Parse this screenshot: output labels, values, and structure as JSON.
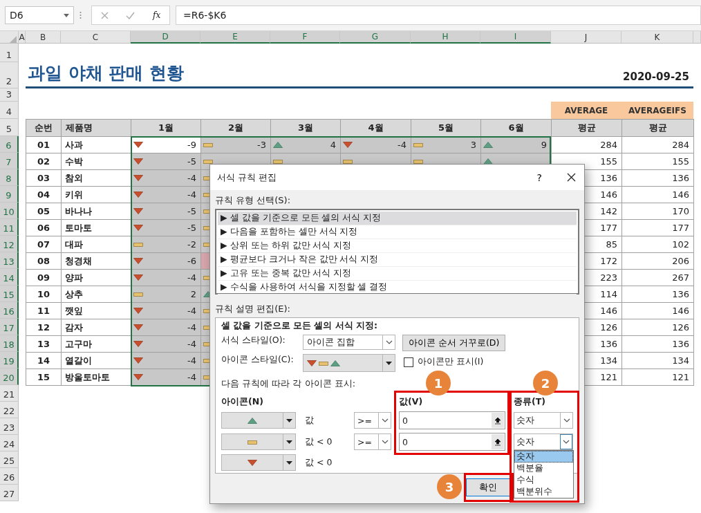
{
  "name_box": {
    "value": "D6"
  },
  "formula_bar": {
    "function_label": "fx",
    "value": "=R6-$K6"
  },
  "column_headers": [
    {
      "label": "A",
      "selected": false
    },
    {
      "label": "B",
      "selected": false
    },
    {
      "label": "C",
      "selected": false
    },
    {
      "label": "D",
      "selected": true
    },
    {
      "label": "E",
      "selected": true
    },
    {
      "label": "F",
      "selected": true
    },
    {
      "label": "G",
      "selected": true
    },
    {
      "label": "H",
      "selected": true
    },
    {
      "label": "I",
      "selected": true
    },
    {
      "label": "J",
      "selected": false
    },
    {
      "label": "K",
      "selected": false
    }
  ],
  "row_headers": [
    {
      "label": "1",
      "selected": false
    },
    {
      "label": "2",
      "selected": false
    },
    {
      "label": "3",
      "selected": false
    },
    {
      "label": "4",
      "selected": false
    },
    {
      "label": "5",
      "selected": false
    },
    {
      "label": "6",
      "selected": true
    },
    {
      "label": "7",
      "selected": true
    },
    {
      "label": "8",
      "selected": true
    },
    {
      "label": "9",
      "selected": true
    },
    {
      "label": "10",
      "selected": true
    },
    {
      "label": "11",
      "selected": true
    },
    {
      "label": "12",
      "selected": true
    },
    {
      "label": "13",
      "selected": true
    },
    {
      "label": "14",
      "selected": true
    },
    {
      "label": "15",
      "selected": true
    },
    {
      "label": "16",
      "selected": true
    },
    {
      "label": "17",
      "selected": true
    },
    {
      "label": "18",
      "selected": true
    },
    {
      "label": "19",
      "selected": true
    },
    {
      "label": "20",
      "selected": true
    },
    {
      "label": "21",
      "selected": false
    },
    {
      "label": "22",
      "selected": false
    },
    {
      "label": "23",
      "selected": false
    },
    {
      "label": "24",
      "selected": false
    },
    {
      "label": "25",
      "selected": false
    },
    {
      "label": "26",
      "selected": false
    },
    {
      "label": "27",
      "selected": false
    }
  ],
  "sheet_title": "과일 야채 판매 현황",
  "report_date": "2020-09-25",
  "formula_notes": [
    "AVERAGE",
    "AVERAGEIFS"
  ],
  "table": {
    "headers": [
      "순번",
      "제품명",
      "1월",
      "2월",
      "3월",
      "4월",
      "5월",
      "6월",
      "평균",
      "평균"
    ],
    "rows": [
      {
        "no": "01",
        "name": "사과",
        "months": [
          {
            "kind": "down",
            "value": "-9",
            "active": true,
            "highlighted": false
          },
          {
            "kind": "bar",
            "value": "-3",
            "active": false,
            "highlighted": false
          },
          {
            "kind": "up",
            "value": "4",
            "active": false,
            "highlighted": false
          },
          {
            "kind": "down",
            "value": "-4",
            "active": false,
            "highlighted": false
          },
          {
            "kind": "bar",
            "value": "3",
            "active": false,
            "highlighted": false
          },
          {
            "kind": "up",
            "value": "9",
            "active": false,
            "highlighted": false
          }
        ],
        "average": "284",
        "averageifs": "284"
      },
      {
        "no": "02",
        "name": "수박",
        "months": [
          {
            "kind": "down",
            "value": "-5",
            "active": false,
            "highlighted": false
          },
          {
            "kind": "bar",
            "active": false,
            "highlighted": false
          },
          {
            "kind": "bar",
            "active": false,
            "highlighted": false
          },
          {
            "kind": "bar",
            "active": false,
            "highlighted": false
          },
          {
            "kind": "bar",
            "active": false,
            "highlighted": false
          },
          {
            "kind": "up",
            "active": false,
            "highlighted": false
          }
        ],
        "average": "155",
        "averageifs": "155"
      },
      {
        "no": "03",
        "name": "참외",
        "months": [
          {
            "kind": "down",
            "value": "-4",
            "active": false,
            "highlighted": false
          },
          {
            "kind": "bar",
            "active": false,
            "highlighted": false
          }
        ],
        "average": "136",
        "averageifs": "136"
      },
      {
        "no": "04",
        "name": "키위",
        "months": [
          {
            "kind": "down",
            "value": "-4",
            "active": false,
            "highlighted": false
          },
          {
            "kind": "bar",
            "active": false,
            "highlighted": false
          }
        ],
        "average": "146",
        "averageifs": "146"
      },
      {
        "no": "05",
        "name": "바나나",
        "months": [
          {
            "kind": "down",
            "value": "-5",
            "active": false,
            "highlighted": false
          },
          {
            "kind": "bar",
            "active": false,
            "highlighted": false
          }
        ],
        "average": "142",
        "averageifs": "170"
      },
      {
        "no": "06",
        "name": "토마토",
        "months": [
          {
            "kind": "down",
            "value": "-5",
            "active": false,
            "highlighted": false
          },
          {
            "kind": "bar",
            "active": false,
            "highlighted": false
          }
        ],
        "average": "177",
        "averageifs": "177"
      },
      {
        "no": "07",
        "name": "대파",
        "months": [
          {
            "kind": "bar",
            "value": "-2",
            "active": false,
            "highlighted": false
          },
          {
            "kind": "bar",
            "active": false,
            "highlighted": false
          }
        ],
        "average": "85",
        "averageifs": "102"
      },
      {
        "no": "08",
        "name": "청경채",
        "months": [
          {
            "kind": "down",
            "value": "-6",
            "active": false,
            "highlighted": false
          },
          {
            "active": false,
            "highlighted": true
          }
        ],
        "average": "172",
        "averageifs": "206"
      },
      {
        "no": "09",
        "name": "양파",
        "months": [
          {
            "kind": "down",
            "value": "-4",
            "active": false,
            "highlighted": false
          },
          {
            "kind": "bar",
            "active": false,
            "highlighted": false
          }
        ],
        "average": "223",
        "averageifs": "267"
      },
      {
        "no": "10",
        "name": "상추",
        "months": [
          {
            "kind": "bar",
            "value": "2",
            "active": false,
            "highlighted": false
          },
          {
            "kind": "up",
            "active": false,
            "highlighted": false
          }
        ],
        "average": "114",
        "averageifs": "136"
      },
      {
        "no": "11",
        "name": "깻잎",
        "months": [
          {
            "kind": "down",
            "value": "-4",
            "active": false,
            "highlighted": false
          },
          {
            "kind": "bar",
            "active": false,
            "highlighted": false
          }
        ],
        "average": "146",
        "averageifs": "146"
      },
      {
        "no": "12",
        "name": "감자",
        "months": [
          {
            "kind": "down",
            "value": "-4",
            "active": false,
            "highlighted": false
          },
          {
            "kind": "bar",
            "active": false,
            "highlighted": false
          }
        ],
        "average": "126",
        "averageifs": "126"
      },
      {
        "no": "13",
        "name": "고구마",
        "months": [
          {
            "kind": "down",
            "value": "-4",
            "active": false,
            "highlighted": false
          },
          {
            "kind": "bar",
            "active": false,
            "highlighted": false
          }
        ],
        "average": "136",
        "averageifs": "136"
      },
      {
        "no": "14",
        "name": "열갈이",
        "months": [
          {
            "kind": "down",
            "value": "-4",
            "active": false,
            "highlighted": false
          },
          {
            "kind": "bar",
            "active": false,
            "highlighted": false
          }
        ],
        "average": "134",
        "averageifs": "134"
      },
      {
        "no": "15",
        "name": "방울토마토",
        "months": [
          {
            "kind": "down",
            "value": "-4",
            "active": false,
            "highlighted": false
          },
          {
            "kind": "bar",
            "active": false,
            "highlighted": false
          }
        ],
        "average": "121",
        "averageifs": "121"
      }
    ]
  },
  "dialog": {
    "title": "서식 규칙 편집",
    "help": "?",
    "rule_type_label": "규칙 유형 선택(S):",
    "rule_types": [
      {
        "label": "▶ 셀 값을 기준으로 모든 셀의 서식 지정",
        "selected": true
      },
      {
        "label": "▶ 다음을 포함하는 셀만 서식 지정",
        "selected": false
      },
      {
        "label": "▶ 상위 또는 하위 값만 서식 지정",
        "selected": false
      },
      {
        "label": "▶ 평균보다 크거나 작은 값만 서식 지정",
        "selected": false
      },
      {
        "label": "▶ 고유 또는 중복 값만 서식 지정",
        "selected": false
      },
      {
        "label": "▶ 수식을 사용하여 서식을 지정할 셀 결정",
        "selected": false
      }
    ],
    "description_label": "규칙 설명 편집(E):",
    "description_heading": "셀 값을 기준으로 모든 셀의 서식 지정:",
    "format_style_label": "서식 스타일(O):",
    "format_style": "아이콘 집합",
    "reverse_button": "아이콘 순서 거꾸로(D)",
    "icon_style_label": "아이콘 스타일(C):",
    "icon_style": [
      {
        "kind": "down"
      },
      {
        "kind": "bar"
      },
      {
        "kind": "up"
      }
    ],
    "icon_only": {
      "label": "아이콘만 표시(I)",
      "checked": false
    },
    "rules_caption": "다음 규칙에 따라 각 아이콘 표시:",
    "icon_header": "아이콘(N)",
    "value_header": "값(V)",
    "type_header": "종류(T)",
    "rules": [
      {
        "kind": "up",
        "condition": "값",
        "operator": ">=",
        "value": "0",
        "type": "숫자",
        "type_open": false
      },
      {
        "kind": "bar",
        "condition": "값 < 0",
        "operator": ">=",
        "value": "0",
        "type": "숫자",
        "type_open": true
      },
      {
        "kind": "down",
        "condition": "값 < 0"
      }
    ],
    "type_options": [
      {
        "label": "숫자",
        "selected": true
      },
      {
        "label": "백분율",
        "selected": false
      },
      {
        "label": "수식",
        "selected": false
      },
      {
        "label": "백분위수",
        "selected": false
      }
    ],
    "ok_button": "확인",
    "callouts": [
      "1",
      "2",
      "3"
    ]
  }
}
